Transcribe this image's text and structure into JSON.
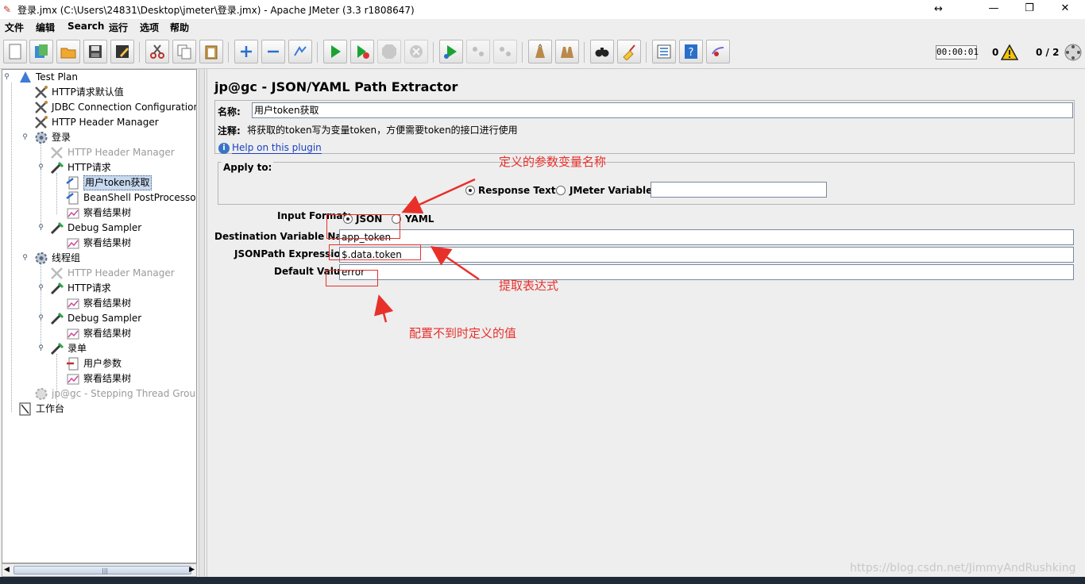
{
  "window": {
    "title": "登录.jmx (C:\\Users\\24831\\Desktop\\jmeter\\登录.jmx) - Apache JMeter (3.3 r1808647)",
    "minimize": "—",
    "maximize": "❐",
    "close": "✕",
    "resize_glyph": "↔"
  },
  "menu": [
    "文件",
    "编辑",
    "Search",
    "运行",
    "选项",
    "帮助"
  ],
  "toolbar": {
    "buttons": [
      "new-icon",
      "templates-icon",
      "open-icon",
      "save-icon",
      "save-as-icon",
      "cut-icon",
      "copy-icon",
      "paste-icon",
      "expand-icon",
      "collapse-icon",
      "toggle-icon",
      "start-icon",
      "start-no-pause-icon",
      "stop-icon",
      "shutdown-icon",
      "remote-start-icon",
      "remote-stop-icon",
      "remote-shutdown-icon",
      "clear-icon",
      "clear-all-icon",
      "search-icon",
      "reset-search-icon",
      "function-helper-icon",
      "help-icon",
      "log-viewer-icon"
    ],
    "timer": "00:00:01",
    "active_threads": "0",
    "thread_ratio": "0 / 2"
  },
  "tree": [
    {
      "label": "Test Plan",
      "icon": "test-plan-icon",
      "enabled": true,
      "selected": false
    },
    {
      "label": "HTTP请求默认值",
      "icon": "config-icon",
      "enabled": true,
      "selected": false
    },
    {
      "label": "JDBC Connection Configuration",
      "icon": "config-icon",
      "enabled": true,
      "selected": false
    },
    {
      "label": "HTTP Header Manager",
      "icon": "config-icon",
      "enabled": true,
      "selected": false
    },
    {
      "label": "登录",
      "icon": "thread-group-icon",
      "enabled": true,
      "selected": false
    },
    {
      "label": "HTTP Header Manager",
      "icon": "config-icon",
      "enabled": false,
      "selected": false
    },
    {
      "label": "HTTP请求",
      "icon": "sampler-icon",
      "enabled": true,
      "selected": false
    },
    {
      "label": "用户token获取",
      "icon": "post-processor-icon",
      "enabled": true,
      "selected": true
    },
    {
      "label": "BeanShell PostProcessor",
      "icon": "post-processor-icon",
      "enabled": true,
      "selected": false
    },
    {
      "label": "察看结果树",
      "icon": "listener-icon",
      "enabled": true,
      "selected": false
    },
    {
      "label": "Debug Sampler",
      "icon": "sampler-icon",
      "enabled": true,
      "selected": false
    },
    {
      "label": "察看结果树",
      "icon": "listener-icon",
      "enabled": true,
      "selected": false
    },
    {
      "label": "线程组",
      "icon": "thread-group-icon",
      "enabled": true,
      "selected": false
    },
    {
      "label": "HTTP Header Manager",
      "icon": "config-icon",
      "enabled": false,
      "selected": false
    },
    {
      "label": "HTTP请求",
      "icon": "sampler-icon",
      "enabled": true,
      "selected": false
    },
    {
      "label": "察看结果树",
      "icon": "listener-icon",
      "enabled": true,
      "selected": false
    },
    {
      "label": "Debug Sampler",
      "icon": "sampler-icon",
      "enabled": true,
      "selected": false
    },
    {
      "label": "察看结果树",
      "icon": "listener-icon",
      "enabled": true,
      "selected": false
    },
    {
      "label": "录单",
      "icon": "sampler-icon",
      "enabled": true,
      "selected": false
    },
    {
      "label": "用户参数",
      "icon": "pre-processor-icon",
      "enabled": true,
      "selected": false
    },
    {
      "label": "察看结果树",
      "icon": "listener-icon",
      "enabled": true,
      "selected": false
    },
    {
      "label": "jp@gc - Stepping Thread Group",
      "icon": "thread-group-icon",
      "enabled": false,
      "selected": false
    },
    {
      "label": "工作台",
      "icon": "workbench-icon",
      "enabled": true,
      "selected": false
    }
  ],
  "panel": {
    "title": "jp@gc - JSON/YAML Path Extractor",
    "name_label": "名称:",
    "name_value": "用户token获取",
    "comments_label": "注释:",
    "comments_value": "将获取的token写为变量token，方便需要token的接口进行使用",
    "help_link": "Help on this plugin",
    "apply_to": {
      "legend": "Apply to:",
      "options": [
        "Response Text",
        "JMeter Variable:"
      ],
      "selected": "Response Text",
      "variable_value": ""
    },
    "input_format": {
      "label": "Input Format:",
      "options": [
        "JSON",
        "YAML"
      ],
      "selected": "JSON"
    },
    "dest_var_label": "Destination Variable Name:",
    "dest_var_value": "app_token",
    "jsonpath_label": "JSONPath Expression:",
    "jsonpath_value": "$.data.token",
    "default_label": "Default Value:",
    "default_value": "error"
  },
  "annotations": {
    "var_name": "定义的参数变量名称",
    "expression": "提取表达式",
    "default": "配置不到时定义的值",
    "color": "#e8302b"
  },
  "watermark": "https://blog.csdn.net/JimmyAndRushking"
}
